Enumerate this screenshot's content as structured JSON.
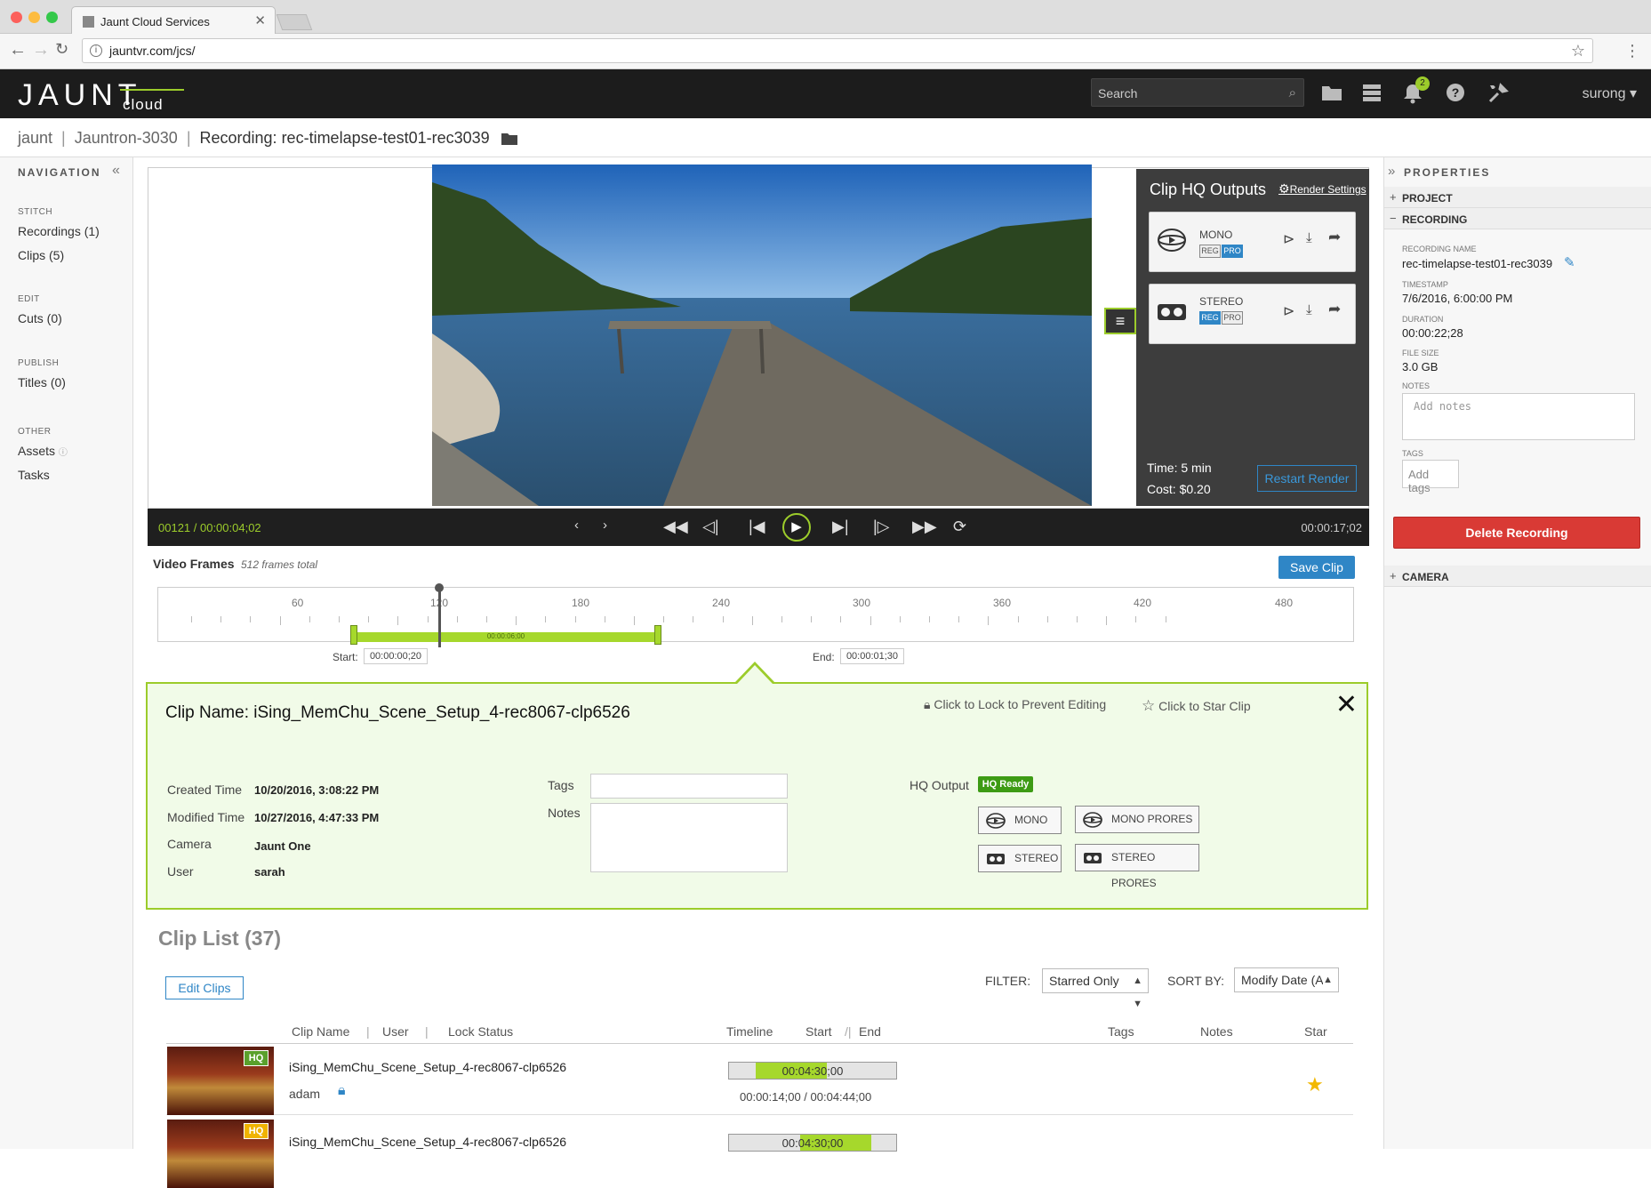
{
  "browser": {
    "tab_title": "Jaunt Cloud Services",
    "url": "jauntvr.com/jcs/"
  },
  "header": {
    "logo_main": "JAUNT",
    "logo_sub": "cloud",
    "search_placeholder": "Search",
    "notification_count": "2",
    "user": "surong",
    "icons": [
      "folder-icon",
      "storage-icon",
      "bell-icon",
      "help-icon",
      "tools-icon"
    ]
  },
  "breadcrumb": {
    "items": [
      "jaunt",
      "Jauntron-3030"
    ],
    "current": "Recording: rec-timelapse-test01-rec3039"
  },
  "navigation": {
    "title": "NAVIGATION",
    "sections": [
      {
        "label": "STITCH",
        "items": [
          "Recordings (1)",
          "Clips (5)"
        ]
      },
      {
        "label": "EDIT",
        "items": [
          "Cuts (0)"
        ]
      },
      {
        "label": "PUBLISH",
        "items": [
          "Titles (0)"
        ]
      },
      {
        "label": "OTHER",
        "items": [
          "Assets",
          "Tasks"
        ]
      }
    ]
  },
  "hq_outputs": {
    "title": "Clip HQ Outputs",
    "render_settings": "Render Settings",
    "cards": [
      {
        "label": "MONO",
        "reg": "REG",
        "pro": "PRO",
        "selected": "PRO"
      },
      {
        "label": "STEREO",
        "reg": "REG",
        "pro": "PRO",
        "selected": "REG"
      }
    ],
    "time": "Time: 5 min",
    "cost": "Cost: $0.20",
    "restart_label": "Restart Render"
  },
  "transport": {
    "current_tc": "00121 / 00:00:04;02",
    "duration": "00:00:17;02"
  },
  "frames": {
    "title": "Video Frames",
    "subtitle": "512 frames total",
    "save_label": "Save Clip",
    "ticks": [
      "60",
      "120",
      "180",
      "240",
      "300",
      "360",
      "420",
      "480"
    ],
    "range_label": "00:00:06;00",
    "start_label": "Start:",
    "start_value": "00:00:00;20",
    "end_label": "End:",
    "end_value": "00:00:01;30"
  },
  "clip_detail": {
    "name": "Clip Name: iSing_MemChu_Scene_Setup_4-rec8067-clp6526",
    "lock_text": "Click to Lock to Prevent Editing",
    "star_text": "Click to Star Clip",
    "fields": [
      {
        "key": "Created Time",
        "value": "10/20/2016, 3:08:22 PM"
      },
      {
        "key": "Modified Time",
        "value": "10/27/2016, 4:47:33 PM"
      },
      {
        "key": "Camera",
        "value": "Jaunt One"
      },
      {
        "key": "User",
        "value": "sarah"
      }
    ],
    "tags_label": "Tags",
    "notes_label": "Notes",
    "hq_output_label": "HQ Output",
    "hq_ready": "HQ Ready",
    "formats": [
      "MONO",
      "MONO PRORES",
      "STEREO",
      "STEREO PRORES"
    ]
  },
  "clip_list": {
    "title": "Clip List (37)",
    "edit_label": "Edit Clips",
    "filter_label": "FILTER:",
    "filter_value": "Starred Only",
    "sort_label": "SORT BY:",
    "sort_value": "Modify Date (A",
    "columns": [
      "Clip Name",
      "User",
      "Lock Status",
      "Timeline",
      "Start",
      "End",
      "Tags",
      "Notes",
      "Star"
    ],
    "rows": [
      {
        "name": "iSing_MemChu_Scene_Setup_4-rec8067-clp6526",
        "user": "adam",
        "timeline": "00:04:30;00",
        "range": "00:00:14;00 / 00:04:44;00",
        "hq": "HQ",
        "hq_color": "#5aa02c"
      },
      {
        "name": "iSing_MemChu_Scene_Setup_4-rec8067-clp6526",
        "user": "",
        "timeline": "00:04:30;00",
        "range": "",
        "hq": "HQ",
        "hq_color": "#f0b400"
      }
    ]
  },
  "properties": {
    "title": "PROPERTIES",
    "sections": [
      "PROJECT",
      "RECORDING",
      "CAMERA"
    ],
    "recording_name_label": "RECORDING NAME",
    "recording_name": "rec-timelapse-test01-rec3039",
    "timestamp_label": "TIMESTAMP",
    "timestamp": "7/6/2016, 6:00:00 PM",
    "duration_label": "DURATION",
    "duration": "00:00:22;28",
    "filesize_label": "FILE SIZE",
    "filesize": "3.0 GB",
    "notes_label": "NOTES",
    "notes_placeholder": "Add notes",
    "tags_label": "TAGS",
    "tags_placeholder": "Add tags",
    "delete_label": "Delete Recording"
  },
  "colors": {
    "accent_green": "#9ccc2b",
    "accent_blue": "#2f86c6",
    "danger": "#d93a35",
    "header_bg": "#1c1c1c"
  }
}
